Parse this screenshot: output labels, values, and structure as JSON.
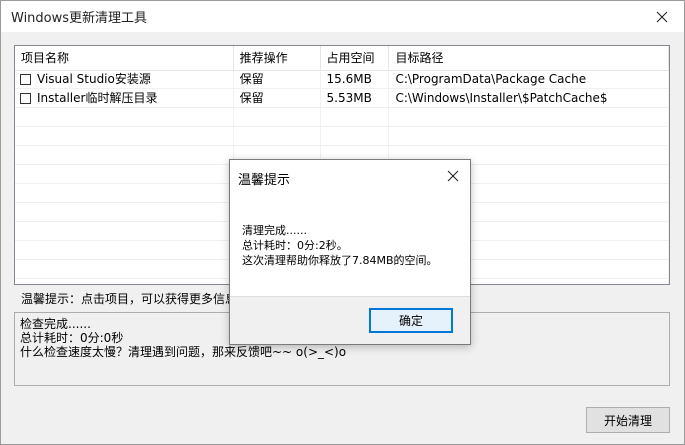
{
  "window": {
    "title": "Windows更新清理工具"
  },
  "list": {
    "columns": [
      "项目名称",
      "推荐操作",
      "占用空间",
      "目标路径"
    ],
    "rows": [
      {
        "name": "Visual Studio安装源",
        "action": "保留",
        "size": "15.6MB",
        "path": "C:\\ProgramData\\Package Cache",
        "checked": false
      },
      {
        "name": "Installer临时解压目录",
        "action": "保留",
        "size": "5.53MB",
        "path": "C:\\Windows\\Installer\\$PatchCache$",
        "checked": false
      }
    ]
  },
  "hint": "温馨提示：点击项目，可以获得更多信息",
  "log": {
    "line1": "检查完成......",
    "line2": "总计耗时：0分:0秒",
    "line3": "什么检查速度太慢？清理遇到问题，那来反馈吧~~ o(>_<)o"
  },
  "buttons": {
    "start": "开始清理"
  },
  "dialog": {
    "title": "温馨提示",
    "line1": "清理完成......",
    "line2": "总计耗时：0分:2秒。",
    "line3": "这次清理帮助你释放了7.84MB的空间。",
    "ok": "确定"
  }
}
